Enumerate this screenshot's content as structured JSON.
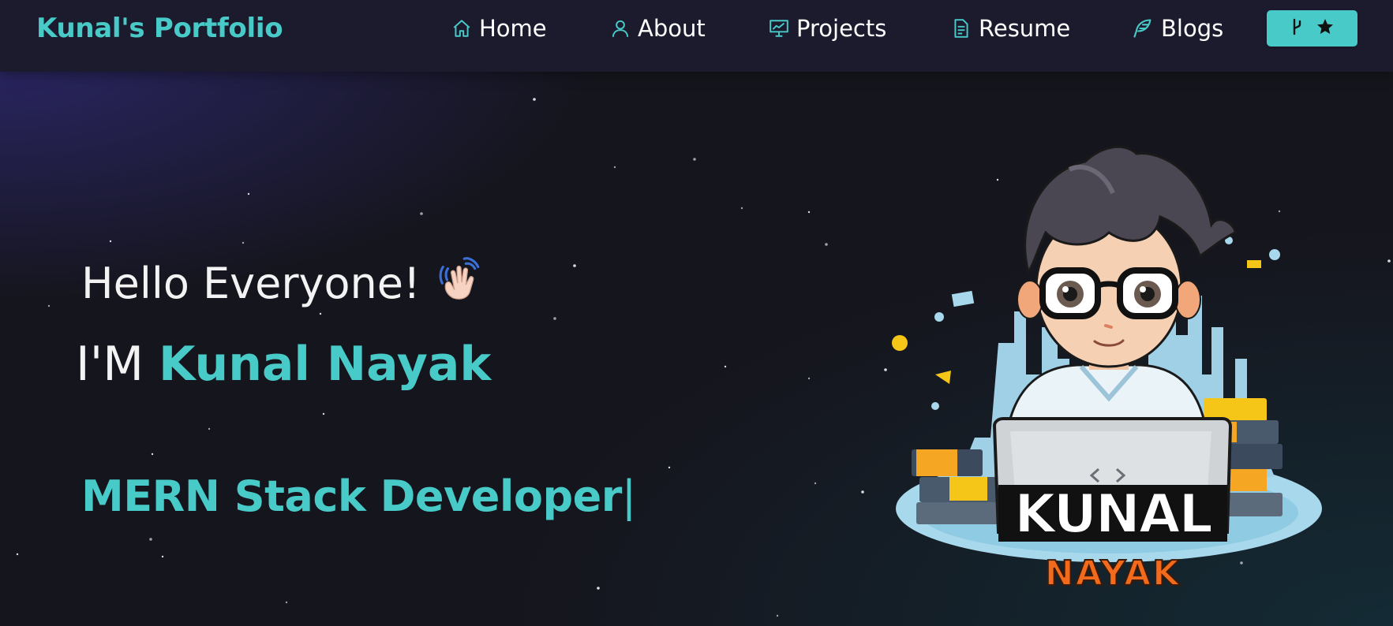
{
  "nav": {
    "brand": "Kunal's Portfolio",
    "items": [
      {
        "label": "Home",
        "icon": "home-icon"
      },
      {
        "label": "About",
        "icon": "user-icon"
      },
      {
        "label": "Projects",
        "icon": "presentation-chart-icon"
      },
      {
        "label": "Resume",
        "icon": "document-icon"
      },
      {
        "label": "Blogs",
        "icon": "feather-icon"
      }
    ],
    "github_button": {
      "icons": [
        "git-fork-icon",
        "star-icon"
      ]
    }
  },
  "hero": {
    "greeting": "Hello Everyone!",
    "greeting_emoji": "wave-hand-icon",
    "intro_prefix": "I'M",
    "name": "Kunal Nayak",
    "role": "MERN Stack Developer",
    "cursor": "|"
  },
  "avatar": {
    "line1": "KUNAL",
    "line2": "NAYAK"
  },
  "colors": {
    "accent": "#48cbc8",
    "navbar": "#1c1b2e",
    "background": "#15151d",
    "text": "#ffffff",
    "nayak_orange": "#f26b1d"
  }
}
